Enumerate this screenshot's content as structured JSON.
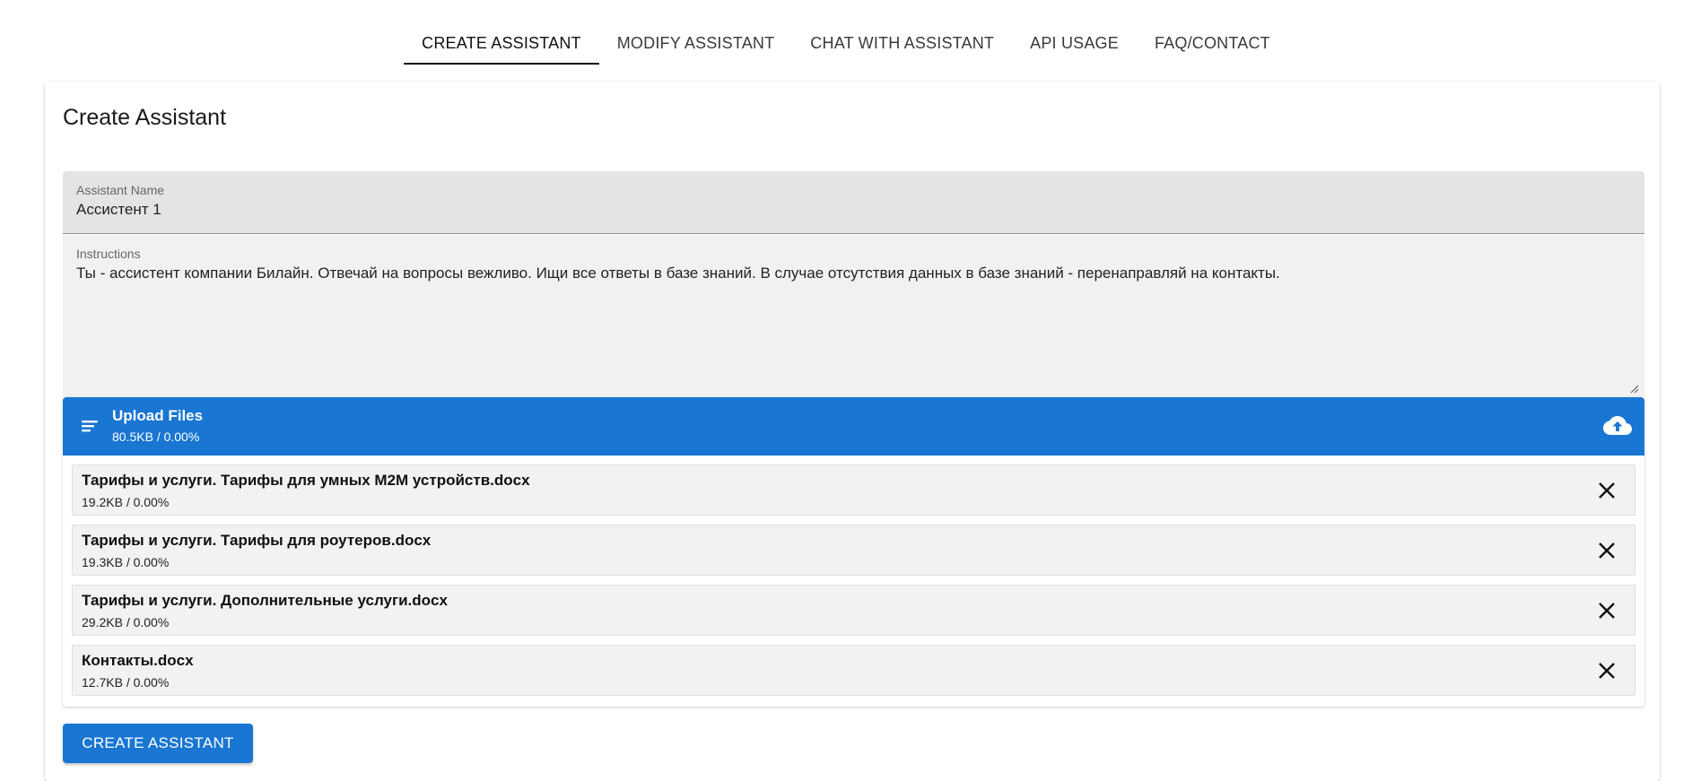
{
  "tabs": [
    {
      "label": "CREATE ASSISTANT",
      "active": true
    },
    {
      "label": "MODIFY ASSISTANT",
      "active": false
    },
    {
      "label": "CHAT WITH ASSISTANT",
      "active": false
    },
    {
      "label": "API USAGE",
      "active": false
    },
    {
      "label": "FAQ/CONTACT",
      "active": false
    }
  ],
  "card": {
    "title": "Create Assistant"
  },
  "form": {
    "name_label": "Assistant Name",
    "name_value": "Ассистент 1",
    "instructions_label": "Instructions",
    "instructions_value": "Ты - ассистент компании Билайн. Отвечай на вопросы вежливо. Ищи все ответы в базе знаний. В случае отсутствия данных в базе знаний - перенаправляй на контакты."
  },
  "upload": {
    "title": "Upload Files",
    "summary": "80.5KB / 0.00%",
    "menu_icon": "sort-lines-icon",
    "upload_icon": "cloud-upload-icon",
    "files": [
      {
        "name": "Тарифы и услуги. Тарифы для умных M2M устройств.docx",
        "size": "19.2KB / 0.00%"
      },
      {
        "name": "Тарифы и услуги. Тарифы для роутеров.docx",
        "size": "19.3KB / 0.00%"
      },
      {
        "name": "Тарифы и услуги. Дополнительные услуги.docx",
        "size": "29.2KB / 0.00%"
      },
      {
        "name": "Контакты.docx",
        "size": "12.7KB / 0.00%"
      }
    ],
    "remove_icon": "close-icon"
  },
  "actions": {
    "create_label": "CREATE ASSISTANT"
  },
  "colors": {
    "primary": "#1976d2",
    "field_bg": "#e4e4e4"
  }
}
